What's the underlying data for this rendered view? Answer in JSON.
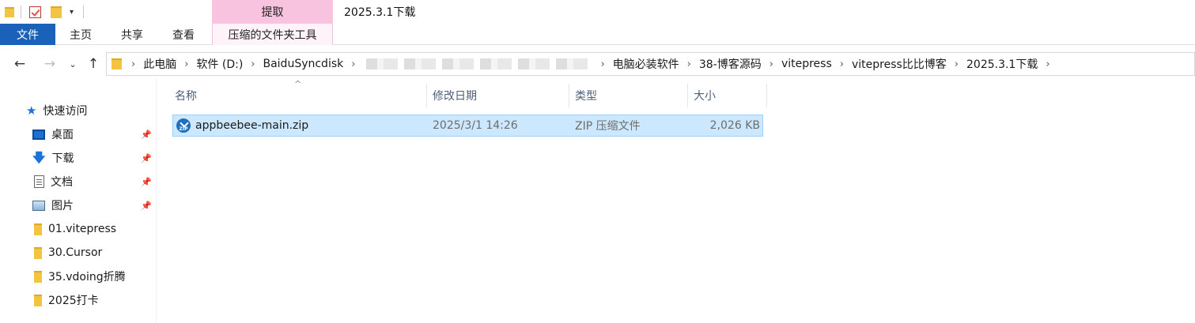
{
  "window": {
    "title": "2025.3.1下载",
    "context_tab_header": "提取"
  },
  "ribbon": {
    "tabs": [
      "文件",
      "主页",
      "共享",
      "查看",
      "压缩的文件夹工具"
    ]
  },
  "address": {
    "crumbs": [
      "此电脑",
      "软件 (D:)",
      "BaiduSyncdisk",
      "电脑必装软件",
      "38-博客源码",
      "vitepress",
      "vitepress比比博客",
      "2025.3.1下载"
    ]
  },
  "sidebar": {
    "quick_access": "快速访问",
    "items": [
      {
        "label": "桌面",
        "icon": "desktop-icon",
        "pinned": true
      },
      {
        "label": "下载",
        "icon": "download-icon",
        "pinned": true
      },
      {
        "label": "文档",
        "icon": "document-icon",
        "pinned": true
      },
      {
        "label": "图片",
        "icon": "pictures-icon",
        "pinned": true
      },
      {
        "label": "01.vitepress",
        "icon": "folder-icon",
        "pinned": false
      },
      {
        "label": "30.Cursor",
        "icon": "folder-icon",
        "pinned": false
      },
      {
        "label": "35.vdoing折腾",
        "icon": "folder-icon",
        "pinned": false
      },
      {
        "label": "2025打卡",
        "icon": "folder-icon",
        "pinned": false
      }
    ]
  },
  "files": {
    "columns": [
      "名称",
      "修改日期",
      "类型",
      "大小"
    ],
    "rows": [
      {
        "name": "appbeebee-main.zip",
        "modified": "2025/3/1 14:26",
        "type": "ZIP 压缩文件",
        "size": "2,026 KB",
        "icon": "zip-icon",
        "selected": true
      }
    ]
  },
  "colors": {
    "file_tab": "#1a62b9",
    "context_tab": "#f7c3de",
    "selection": "#cce8ff"
  }
}
